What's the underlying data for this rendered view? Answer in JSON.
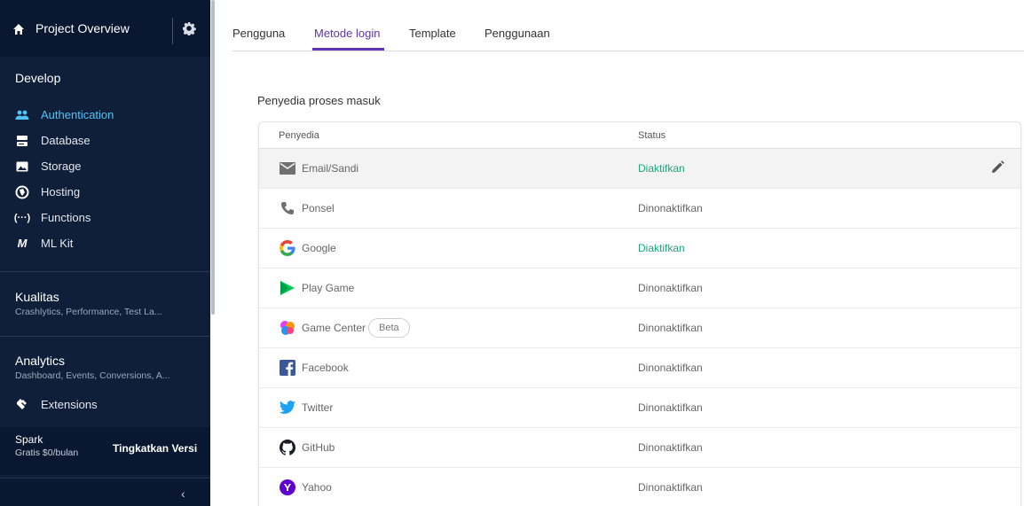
{
  "sidebar": {
    "project_title": "Project Overview",
    "develop_title": "Develop",
    "develop_items": [
      {
        "label": "Authentication",
        "icon": "people-icon",
        "active": true
      },
      {
        "label": "Database",
        "icon": "database-icon",
        "active": false
      },
      {
        "label": "Storage",
        "icon": "image-icon",
        "active": false
      },
      {
        "label": "Hosting",
        "icon": "globe-icon",
        "active": false
      },
      {
        "label": "Functions",
        "icon": "functions-icon",
        "active": false
      },
      {
        "label": "ML Kit",
        "icon": "ml-kit-icon",
        "active": false
      }
    ],
    "quality": {
      "title": "Kualitas",
      "subtitle": "Crashlytics, Performance, Test La..."
    },
    "analytics": {
      "title": "Analytics",
      "subtitle": "Dashboard, Events, Conversions, A..."
    },
    "extensions_label": "Extensions",
    "plan": {
      "name": "Spark",
      "price": "Gratis $0/bulan",
      "upgrade_label": "Tingkatkan Versi"
    },
    "collapse_glyph": "‹"
  },
  "tabs": [
    {
      "label": "Pengguna",
      "active": false
    },
    {
      "label": "Metode login",
      "active": true
    },
    {
      "label": "Template",
      "active": false
    },
    {
      "label": "Penggunaan",
      "active": false
    }
  ],
  "section_title": "Penyedia proses masuk",
  "table": {
    "headers": {
      "provider": "Penyedia",
      "status": "Status"
    },
    "rows": [
      {
        "provider": "Email/Sandi",
        "icon": "email-icon",
        "status": "Diaktifkan",
        "enabled": true,
        "highlight": true
      },
      {
        "provider": "Ponsel",
        "icon": "phone-icon",
        "status": "Dinonaktifkan",
        "enabled": false
      },
      {
        "provider": "Google",
        "icon": "google-icon",
        "status": "Diaktifkan",
        "enabled": true
      },
      {
        "provider": "Play Game",
        "icon": "play-games-icon",
        "status": "Dinonaktifkan",
        "enabled": false
      },
      {
        "provider": "Game Center",
        "icon": "game-center-icon",
        "status": "Dinonaktifkan",
        "enabled": false,
        "badge": "Beta"
      },
      {
        "provider": "Facebook",
        "icon": "facebook-icon",
        "status": "Dinonaktifkan",
        "enabled": false
      },
      {
        "provider": "Twitter",
        "icon": "twitter-icon",
        "status": "Dinonaktifkan",
        "enabled": false
      },
      {
        "provider": "GitHub",
        "icon": "github-icon",
        "status": "Dinonaktifkan",
        "enabled": false
      },
      {
        "provider": "Yahoo",
        "icon": "yahoo-icon",
        "status": "Dinonaktifkan",
        "enabled": false
      }
    ]
  },
  "colors": {
    "sidebar_bg": "#0f1f3a",
    "active_nav": "#4fc3f7",
    "tab_active": "#5e35b1",
    "status_enabled": "#1aa87a"
  }
}
